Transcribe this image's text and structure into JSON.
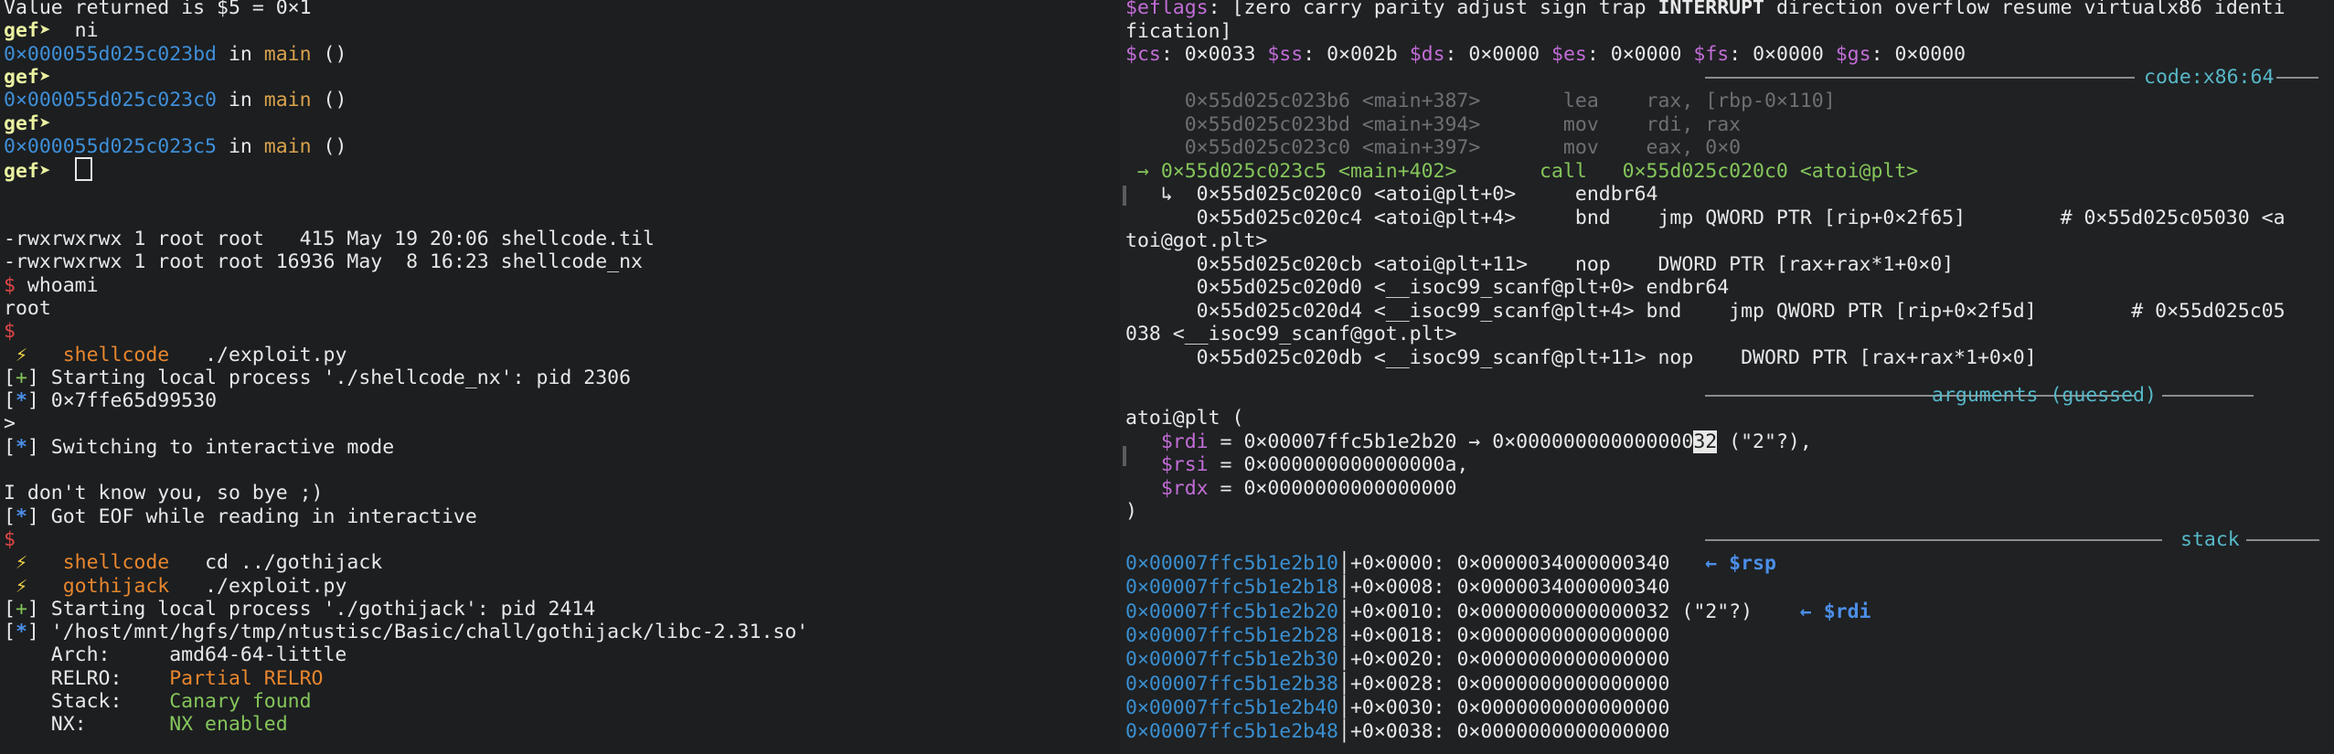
{
  "left": {
    "lines": [
      {
        "id": "l1",
        "segments": [
          {
            "t": "Value returned is $5 = 0×1",
            "c": "c-white"
          }
        ]
      },
      {
        "id": "l2",
        "segments": [
          {
            "t": "gef➤  ",
            "c": "c-gef"
          },
          {
            "t": "ni",
            "c": "c-white"
          }
        ]
      },
      {
        "id": "l3",
        "segments": [
          {
            "t": "0×000055d025c023bd",
            "c": "c-addr"
          },
          {
            "t": " in ",
            "c": "c-white"
          },
          {
            "t": "main",
            "c": "c-func"
          },
          {
            "t": " ()",
            "c": "c-white"
          }
        ]
      },
      {
        "id": "l4",
        "segments": [
          {
            "t": "gef➤  ",
            "c": "c-gef"
          }
        ]
      },
      {
        "id": "l5",
        "segments": [
          {
            "t": "0×000055d025c023c0",
            "c": "c-addr"
          },
          {
            "t": " in ",
            "c": "c-white"
          },
          {
            "t": "main",
            "c": "c-func"
          },
          {
            "t": " ()",
            "c": "c-white"
          }
        ]
      },
      {
        "id": "l6",
        "segments": [
          {
            "t": "gef➤  ",
            "c": "c-gef"
          }
        ]
      },
      {
        "id": "l7",
        "segments": [
          {
            "t": "0×000055d025c023c5",
            "c": "c-addr"
          },
          {
            "t": " in ",
            "c": "c-white"
          },
          {
            "t": "main",
            "c": "c-func"
          },
          {
            "t": " ()",
            "c": "c-white"
          }
        ]
      },
      {
        "id": "l8",
        "segments": [
          {
            "t": "gef➤  ",
            "c": "c-gef"
          }
        ],
        "cursor": true
      },
      {
        "id": "l9",
        "segments": []
      },
      {
        "id": "l10",
        "segments": []
      },
      {
        "id": "l11",
        "segments": [
          {
            "t": "-rwxrwxrwx 1 root root   415 May 19 20:06 shellcode.til",
            "c": "c-white"
          }
        ]
      },
      {
        "id": "l12",
        "segments": [
          {
            "t": "-rwxrwxrwx 1 root root 16936 May  8 16:23 shellcode_nx",
            "c": "c-white"
          }
        ]
      },
      {
        "id": "l13",
        "segments": [
          {
            "t": "$ ",
            "c": "c-red"
          },
          {
            "t": "whoami",
            "c": "c-white"
          }
        ]
      },
      {
        "id": "l14",
        "segments": [
          {
            "t": "root",
            "c": "c-white"
          }
        ]
      },
      {
        "id": "l15",
        "segments": [
          {
            "t": "$",
            "c": "c-red"
          }
        ]
      },
      {
        "id": "l16",
        "segments": [
          {
            "t": " ⚡   ",
            "c": "c-yellow"
          },
          {
            "t": "shellcode",
            "c": "c-orange"
          },
          {
            "t": "   ./exploit.py",
            "c": "c-white"
          }
        ]
      },
      {
        "id": "l17",
        "segments": [
          {
            "t": "[",
            "c": "c-white"
          },
          {
            "t": "+",
            "c": "c-green"
          },
          {
            "t": "] Starting local process './shellcode_nx': pid 2306",
            "c": "c-white"
          }
        ]
      },
      {
        "id": "l18",
        "segments": [
          {
            "t": "[",
            "c": "c-white"
          },
          {
            "t": "*",
            "c": "c-blue"
          },
          {
            "t": "] 0×7ffe65d99530",
            "c": "c-white"
          }
        ]
      },
      {
        "id": "l19",
        "segments": [
          {
            "t": ">",
            "c": "c-white"
          }
        ]
      },
      {
        "id": "l20",
        "segments": [
          {
            "t": "[",
            "c": "c-white"
          },
          {
            "t": "*",
            "c": "c-blue"
          },
          {
            "t": "] Switching to interactive mode",
            "c": "c-white"
          }
        ]
      },
      {
        "id": "l21",
        "segments": []
      },
      {
        "id": "l22",
        "segments": [
          {
            "t": "I don't know you, so bye ;)",
            "c": "c-white"
          }
        ]
      },
      {
        "id": "l23",
        "segments": [
          {
            "t": "[",
            "c": "c-white"
          },
          {
            "t": "*",
            "c": "c-blue"
          },
          {
            "t": "] Got EOF while reading in interactive",
            "c": "c-white"
          }
        ]
      },
      {
        "id": "l24",
        "segments": [
          {
            "t": "$",
            "c": "c-red"
          }
        ]
      },
      {
        "id": "l25",
        "segments": [
          {
            "t": " ⚡   ",
            "c": "c-yellow"
          },
          {
            "t": "shellcode",
            "c": "c-orange"
          },
          {
            "t": "   cd ../gothijack",
            "c": "c-white"
          }
        ]
      },
      {
        "id": "l26",
        "segments": [
          {
            "t": " ⚡   ",
            "c": "c-yellow"
          },
          {
            "t": "gothijack",
            "c": "c-orange"
          },
          {
            "t": "   ./exploit.py",
            "c": "c-white"
          }
        ]
      },
      {
        "id": "l27",
        "segments": [
          {
            "t": "[",
            "c": "c-white"
          },
          {
            "t": "+",
            "c": "c-green"
          },
          {
            "t": "] Starting local process './gothijack': pid 2414",
            "c": "c-white"
          }
        ]
      },
      {
        "id": "l28",
        "segments": [
          {
            "t": "[",
            "c": "c-white"
          },
          {
            "t": "*",
            "c": "c-blue"
          },
          {
            "t": "] '/host/mnt/hgfs/tmp/ntustisc/Basic/chall/gothijack/libc-2.31.so'",
            "c": "c-white"
          }
        ]
      },
      {
        "id": "l29",
        "segments": [
          {
            "t": "    Arch:     amd64-64-little",
            "c": "c-white"
          }
        ]
      },
      {
        "id": "l30",
        "segments": [
          {
            "t": "    RELRO:    ",
            "c": "c-white"
          },
          {
            "t": "Partial RELRO",
            "c": "c-orange"
          }
        ]
      },
      {
        "id": "l31",
        "segments": [
          {
            "t": "    Stack:    ",
            "c": "c-white"
          },
          {
            "t": "Canary found",
            "c": "c-green"
          }
        ]
      },
      {
        "id": "l32",
        "segments": [
          {
            "t": "    NX:       ",
            "c": "c-white"
          },
          {
            "t": "NX enabled",
            "c": "c-green"
          }
        ]
      }
    ]
  },
  "right": {
    "header_lines": [
      {
        "id": "r1",
        "segments": [
          {
            "t": "$eflags",
            "c": "c-pink"
          },
          {
            "t": ": [zero carry parity adjust sign trap ",
            "c": "c-white"
          },
          {
            "t": "INTERRUPT",
            "c": "c-white bold"
          },
          {
            "t": " direction overflow resume virtualx86 identi",
            "c": "c-white"
          }
        ]
      },
      {
        "id": "r2",
        "segments": [
          {
            "t": "fication]",
            "c": "c-white"
          }
        ]
      },
      {
        "id": "r3",
        "segments": [
          {
            "t": "$cs",
            "c": "c-pink"
          },
          {
            "t": ": 0×0033 ",
            "c": "c-white"
          },
          {
            "t": "$ss",
            "c": "c-pink"
          },
          {
            "t": ": 0×002b ",
            "c": "c-white"
          },
          {
            "t": "$ds",
            "c": "c-pink"
          },
          {
            "t": ": 0×0000 ",
            "c": "c-white"
          },
          {
            "t": "$es",
            "c": "c-pink"
          },
          {
            "t": ": 0×0000 ",
            "c": "c-white"
          },
          {
            "t": "$fs",
            "c": "c-pink"
          },
          {
            "t": ": 0×0000 ",
            "c": "c-white"
          },
          {
            "t": "$gs",
            "c": "c-pink"
          },
          {
            "t": ": 0×0000",
            "c": "c-white"
          }
        ]
      }
    ],
    "code_title": "code:x86:64",
    "code_lines": [
      {
        "id": "c1",
        "segments": [
          {
            "t": "     0×55d025c023b6 <main+387>       lea    rax, [rbp-0×110]",
            "c": "c-dim"
          }
        ]
      },
      {
        "id": "c2",
        "segments": [
          {
            "t": "     0×55d025c023bd <main+394>       mov    rdi, rax",
            "c": "c-dim"
          }
        ]
      },
      {
        "id": "c3",
        "segments": [
          {
            "t": "     0×55d025c023c0 <main+397>       mov    eax, 0×0",
            "c": "c-dim"
          }
        ]
      },
      {
        "id": "c4",
        "segments": [
          {
            "t": " → 0×55d025c023c5 <main+402>       call   0×55d025c020c0 <atoi@plt>",
            "c": "c-green"
          }
        ]
      },
      {
        "id": "c5",
        "segments": [
          {
            "t": "   ↳  0×55d025c020c0 <atoi@plt+0>     endbr64",
            "c": "c-white"
          }
        ]
      },
      {
        "id": "c6",
        "segments": [
          {
            "t": "      0×55d025c020c4 <atoi@plt+4>     bnd    jmp QWORD PTR [rip+0×2f65]        # 0×55d025c05030 <a",
            "c": "c-white"
          }
        ]
      },
      {
        "id": "c7",
        "segments": [
          {
            "t": "toi@got.plt>",
            "c": "c-white"
          }
        ]
      },
      {
        "id": "c8",
        "segments": [
          {
            "t": "      0×55d025c020cb <atoi@plt+11>    nop    DWORD PTR [rax+rax*1+0×0]",
            "c": "c-white"
          }
        ]
      },
      {
        "id": "c9",
        "segments": [
          {
            "t": "      0×55d025c020d0 <__isoc99_scanf@plt+0> endbr64",
            "c": "c-white"
          }
        ]
      },
      {
        "id": "c10",
        "segments": [
          {
            "t": "      0×55d025c020d4 <__isoc99_scanf@plt+4> bnd    jmp QWORD PTR [rip+0×2f5d]        # 0×55d025c05",
            "c": "c-white"
          }
        ]
      },
      {
        "id": "c11",
        "segments": [
          {
            "t": "038 <__isoc99_scanf@got.plt>",
            "c": "c-white"
          }
        ]
      },
      {
        "id": "c12",
        "segments": [
          {
            "t": "      0×55d025c020db <__isoc99_scanf@plt+11> nop    DWORD PTR [rax+rax*1+0×0]",
            "c": "c-white"
          }
        ]
      }
    ],
    "args_title": "arguments (guessed)",
    "args_lines": [
      {
        "id": "a1",
        "segments": [
          {
            "t": "atoi@plt (",
            "c": "c-white"
          }
        ]
      },
      {
        "id": "a2",
        "segments": [
          {
            "t": "   $rdi",
            "c": "c-pink"
          },
          {
            "t": " = 0×00007ffc5b1e2b20 → 0×000000000000000",
            "c": "c-white"
          },
          {
            "t": "32",
            "c": "badge-sel"
          },
          {
            "t": " (\"2\"?),",
            "c": "c-white"
          }
        ]
      },
      {
        "id": "a3",
        "segments": [
          {
            "t": "   $rsi",
            "c": "c-pink"
          },
          {
            "t": " = 0×000000000000000a,",
            "c": "c-white"
          }
        ]
      },
      {
        "id": "a4",
        "segments": [
          {
            "t": "   $rdx",
            "c": "c-pink"
          },
          {
            "t": " = 0×0000000000000000",
            "c": "c-white"
          }
        ]
      },
      {
        "id": "a5",
        "segments": [
          {
            "t": ")",
            "c": "c-white"
          }
        ]
      }
    ],
    "stack_title": "stack",
    "stack_lines": [
      {
        "id": "s1",
        "segments": [
          {
            "t": "0×00007ffc5b1e2b10",
            "c": "c-stack"
          },
          {
            "t": "│+0×0000: 0×0000034000000340   ",
            "c": "c-white"
          },
          {
            "t": "← $rsp",
            "c": "c-blue"
          }
        ]
      },
      {
        "id": "s2",
        "segments": [
          {
            "t": "0×00007ffc5b1e2b18",
            "c": "c-stack"
          },
          {
            "t": "│+0×0008: 0×0000034000000340",
            "c": "c-white"
          }
        ]
      },
      {
        "id": "s3",
        "segments": [
          {
            "t": "0×00007ffc5b1e2b20",
            "c": "c-stack"
          },
          {
            "t": "│+0×0010: 0×0000000000000032 (\"2\"?)    ",
            "c": "c-white"
          },
          {
            "t": "← $rdi",
            "c": "c-blue"
          }
        ]
      },
      {
        "id": "s4",
        "segments": [
          {
            "t": "0×00007ffc5b1e2b28",
            "c": "c-stack"
          },
          {
            "t": "│+0×0018: 0×0000000000000000",
            "c": "c-white"
          }
        ]
      },
      {
        "id": "s5",
        "segments": [
          {
            "t": "0×00007ffc5b1e2b30",
            "c": "c-stack"
          },
          {
            "t": "│+0×0020: 0×0000000000000000",
            "c": "c-white"
          }
        ]
      },
      {
        "id": "s6",
        "segments": [
          {
            "t": "0×00007ffc5b1e2b38",
            "c": "c-stack"
          },
          {
            "t": "│+0×0028: 0×0000000000000000",
            "c": "c-white"
          }
        ]
      },
      {
        "id": "s7",
        "segments": [
          {
            "t": "0×00007ffc5b1e2b40",
            "c": "c-stack"
          },
          {
            "t": "│+0×0030: 0×0000000000000000",
            "c": "c-white"
          }
        ]
      },
      {
        "id": "s8",
        "segments": [
          {
            "t": "0×00007ffc5b1e2b48",
            "c": "c-stack"
          },
          {
            "t": "│+0×0038: 0×0000000000000000",
            "c": "c-white"
          }
        ]
      }
    ]
  }
}
